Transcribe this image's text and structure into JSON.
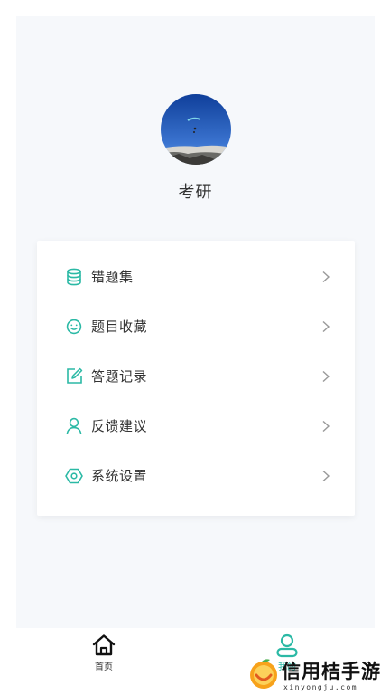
{
  "profile": {
    "username": "考研"
  },
  "menu": {
    "items": [
      {
        "label": "错题集",
        "icon": "database-icon"
      },
      {
        "label": "题目收藏",
        "icon": "smile-icon"
      },
      {
        "label": "答题记录",
        "icon": "edit-icon"
      },
      {
        "label": "反馈建议",
        "icon": "user-icon"
      },
      {
        "label": "系统设置",
        "icon": "settings-icon"
      }
    ]
  },
  "tabbar": {
    "home_label": "首页",
    "mine_label": "我的"
  },
  "watermark": {
    "title": "信用桔手游",
    "url": "xinyongju.com"
  },
  "colors": {
    "accent": "#2bb9a5",
    "background": "#f6f8fb",
    "text": "#333333"
  }
}
